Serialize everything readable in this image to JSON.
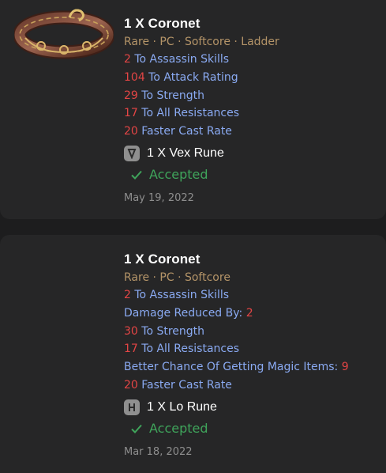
{
  "trades": [
    {
      "title": "1 X Coronet",
      "meta": "Rare · PC · Softcore · Ladder",
      "stats": [
        {
          "num": "2",
          "text": " To Assassin Skills"
        },
        {
          "num": "104",
          "text": " To Attack Rating"
        },
        {
          "num": "29",
          "text": " To Strength"
        },
        {
          "num": "17",
          "text": " To All Resistances"
        },
        {
          "num": "20",
          "text": " Faster Cast Rate"
        }
      ],
      "rune": {
        "label": "1 X Vex Rune",
        "icon": "vex-rune-icon"
      },
      "status": "Accepted",
      "date": "May 19, 2022"
    },
    {
      "title": "1 X Coronet",
      "meta": "Rare · PC · Softcore",
      "stats": [
        {
          "num": "2",
          "text": " To Assassin Skills"
        },
        {
          "text": "Damage Reduced By: ",
          "num_after": "2"
        },
        {
          "num": "30",
          "text": " To Strength"
        },
        {
          "num": "17",
          "text": " To All Resistances"
        },
        {
          "text": "Better Chance Of Getting Magic Items: ",
          "num_after": "9"
        },
        {
          "num": "20",
          "text": " Faster Cast Rate"
        }
      ],
      "rune": {
        "label": "1 X Lo Rune",
        "icon": "lo-rune-icon"
      },
      "status": "Accepted",
      "date": "Mar 18, 2022"
    }
  ],
  "colors": {
    "background": "#1d1d1e",
    "card": "#262627",
    "meta": "#b49468",
    "stat_text": "#8aaaf2",
    "stat_number": "#e34545",
    "accepted": "#3fa45b",
    "date": "#8e8e8e"
  }
}
